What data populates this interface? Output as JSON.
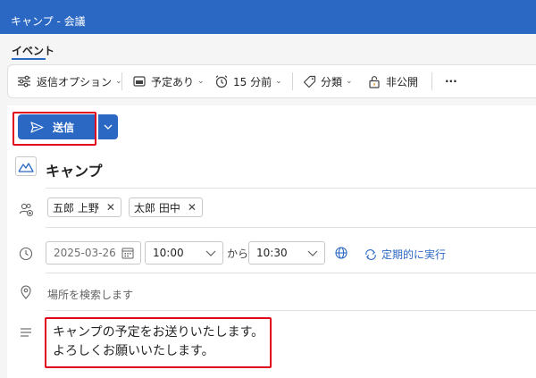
{
  "window": {
    "title": "キャンプ - 会議"
  },
  "ribbon": {
    "active_tab": "イベント"
  },
  "toolbar": {
    "reply_options": "返信オプション",
    "show_as": "予定あり",
    "reminder": "15 分前",
    "categorize": "分類",
    "private": "非公開",
    "more": "···"
  },
  "compose": {
    "send_label": "送信"
  },
  "event": {
    "title": "キャンプ",
    "attendees": [
      {
        "name": "五郎 上野"
      },
      {
        "name": "太郎 田中"
      }
    ],
    "start_date": "2025-03-26",
    "start_time": "10:00",
    "to_label": "から",
    "end_time": "10:30",
    "recurrence_label": "定期的に実行",
    "location_placeholder": "場所を検索します",
    "body_lines": [
      "キャンプの予定をお送りいたします。",
      "よろしくお願いいたします。"
    ]
  },
  "colors": {
    "accent": "#2b68c4",
    "highlight": "#e0001b"
  }
}
